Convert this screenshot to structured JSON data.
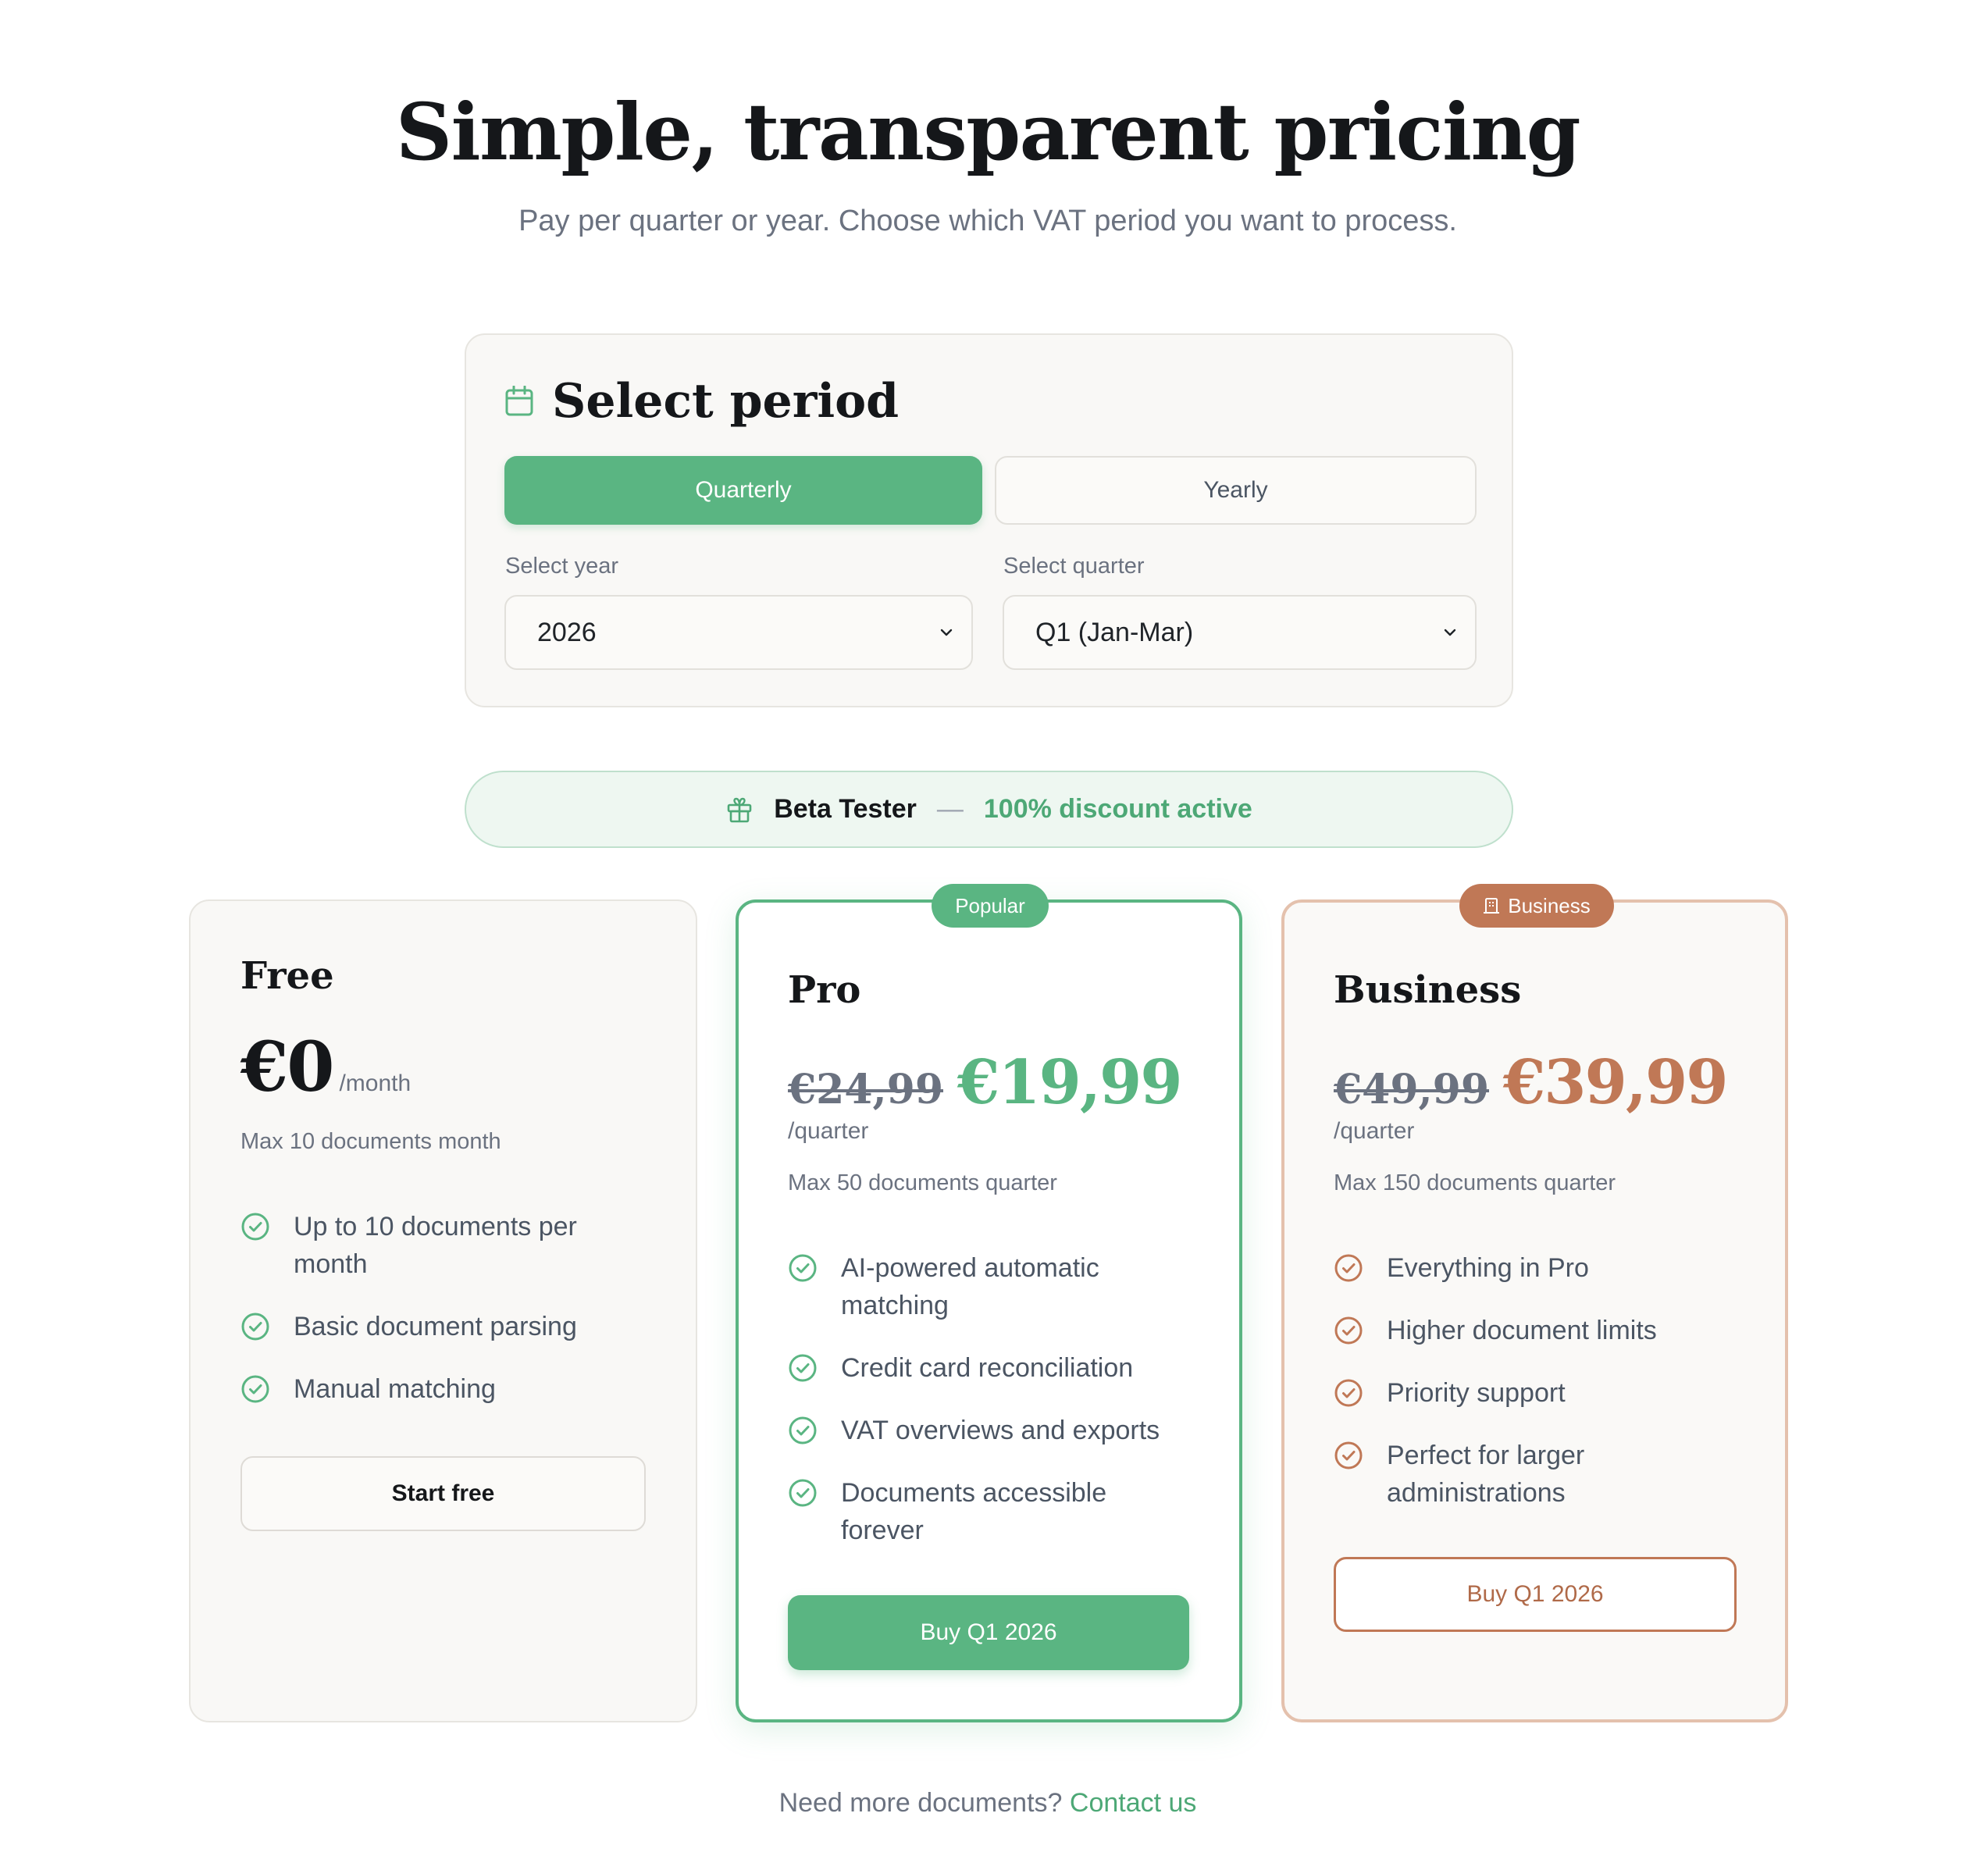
{
  "hero": {
    "title": "Simple, transparent pricing",
    "subtitle": "Pay per quarter or year. Choose which VAT period you want to process."
  },
  "period": {
    "icon": "calendar-icon",
    "title": "Select period",
    "tabs": {
      "quarterly": "Quarterly",
      "yearly": "Yearly"
    },
    "active_tab": "Quarterly",
    "year_label": "Select year",
    "year_value": "2026",
    "quarter_label": "Select quarter",
    "quarter_value": "Q1 (Jan-Mar)"
  },
  "beta": {
    "icon": "gift-icon",
    "name": "Beta Tester",
    "dash": "—",
    "discount": "100% discount active"
  },
  "plans": {
    "free": {
      "name": "Free",
      "price": "€0",
      "unit": "/month",
      "max_docs": "Max 10 documents month",
      "features": [
        "Up to 10 documents per month",
        "Basic document parsing",
        "Manual matching"
      ],
      "cta": "Start free"
    },
    "pro": {
      "ribbon": "Popular",
      "name": "Pro",
      "old_price": "€24,99",
      "price": "€19,99",
      "unit": "/quarter",
      "max_docs": "Max 50 documents quarter",
      "features": [
        "AI-powered automatic matching",
        "Credit card reconciliation",
        "VAT overviews and exports",
        "Documents accessible forever"
      ],
      "cta": "Buy Q1 2026"
    },
    "business": {
      "ribbon": "Business",
      "ribbon_icon": "building-icon",
      "name": "Business",
      "old_price": "€49,99",
      "price": "€39,99",
      "unit": "/quarter",
      "max_docs": "Max 150 documents quarter",
      "features": [
        "Everything in Pro",
        "Higher document limits",
        "Priority support",
        "Perfect for larger administrations"
      ],
      "cta": "Buy Q1 2026"
    }
  },
  "footer": {
    "text": "Need more documents?",
    "link": "Contact us"
  },
  "colors": {
    "green": "#5ab582",
    "green_text": "#4da876",
    "copper": "#c07856",
    "muted": "#6b7280"
  }
}
